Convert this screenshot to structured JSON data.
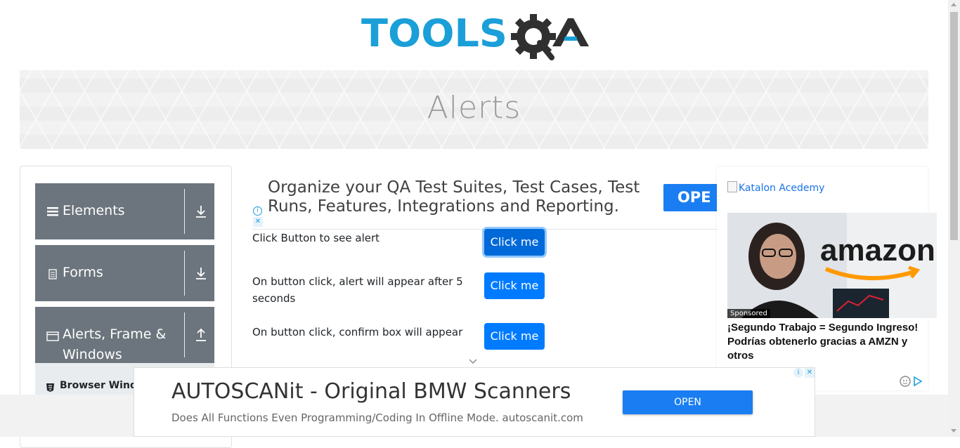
{
  "logo": {
    "text_part1": "TOOLS",
    "text_part2": "QA"
  },
  "banner": {
    "title": "Alerts"
  },
  "sidebar": {
    "groups": [
      {
        "label": "Elements",
        "icon": "menu-icon",
        "arrow": "download-arrow-icon"
      },
      {
        "label": "Forms",
        "icon": "form-icon",
        "arrow": "download-arrow-icon"
      },
      {
        "label": "Alerts, Frame & Windows",
        "label_line1": "Alerts, Frame &",
        "label_line2": "Windows",
        "icon": "window-icon",
        "arrow": "upload-arrow-icon"
      }
    ],
    "active_item": {
      "label": "Browser Windows",
      "visible_label": "Browser Wind"
    }
  },
  "ad_top": {
    "text": "Organize your QA Test Suites, Test Cases, Test Runs, Features, Integrations and Reporting.",
    "button": "OPE"
  },
  "alerts": [
    {
      "label": "Click Button to see alert",
      "button": "Click me"
    },
    {
      "label": "On button click, alert will appear after 5 seconds",
      "button": "Click me"
    },
    {
      "label": "On button click, confirm box will appear",
      "button": "Click me"
    }
  ],
  "ad_right": {
    "image_alt": "Katalon Acedemy",
    "badge": "Sponsored",
    "headline": "¡Segundo Trabajo = Segundo Ingreso! Podrías obtenerlo gracias a AMZN y otros",
    "brand": "amazon"
  },
  "ad_bottom": {
    "title": "AUTOSCANit - Original BMW Scanners",
    "subtitle": "Does All Functions Even Programming/Coding In Offline Mode. autoscanit.com",
    "button": "OPEN"
  },
  "colors": {
    "primary": "#007bff",
    "sidebar_group": "#6c757d",
    "logo_blue": "#1a9fd8",
    "logo_dark": "#303030",
    "ad_button": "#1a7ef2"
  }
}
